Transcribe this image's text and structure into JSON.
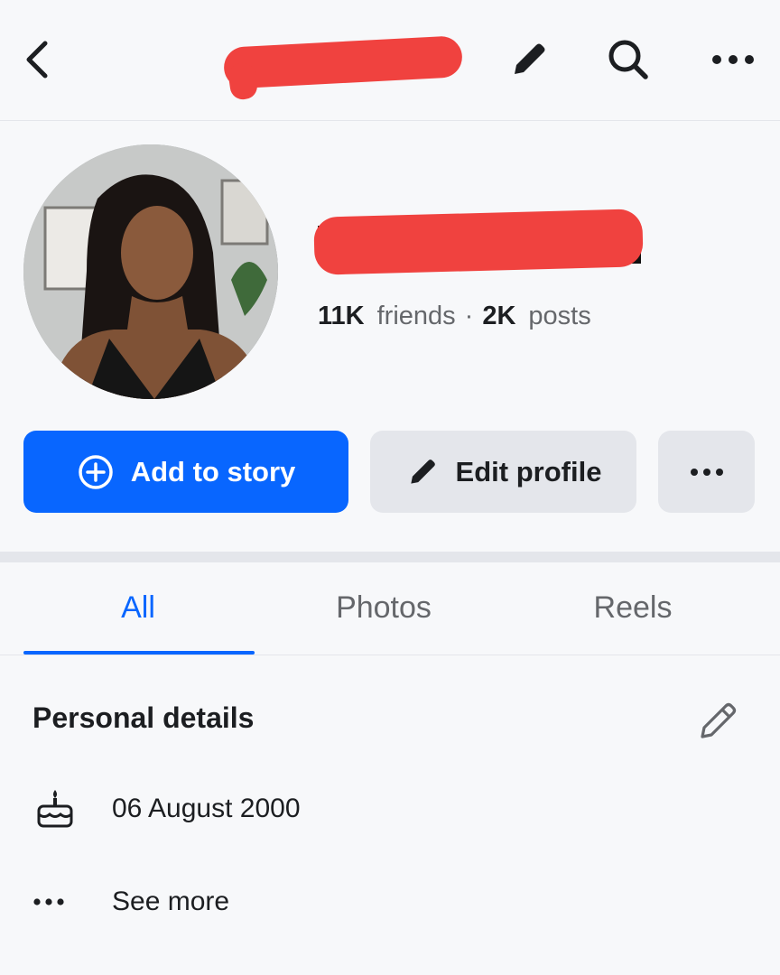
{
  "header": {
    "icons": {
      "back": "chevron-left-icon",
      "edit": "pencil-icon",
      "search": "search-icon",
      "more": "more-horizontal-icon"
    }
  },
  "profile": {
    "friends_count": "11K",
    "friends_label": "friends",
    "separator": "·",
    "posts_count": "2K",
    "posts_label": "posts"
  },
  "actions": {
    "add_story": "Add to story",
    "edit_profile": "Edit profile",
    "colors": {
      "primary": "#0866ff",
      "secondary": "#e4e6eb"
    }
  },
  "tabs": [
    {
      "label": "All",
      "active": true
    },
    {
      "label": "Photos",
      "active": false
    },
    {
      "label": "Reels",
      "active": false
    }
  ],
  "personal_details": {
    "title": "Personal details",
    "birthday": "06 August 2000",
    "see_more": "See more"
  },
  "colors": {
    "accent": "#0866ff",
    "text": "#1c1e21",
    "muted": "#65676b",
    "redaction": "#f0423f"
  }
}
